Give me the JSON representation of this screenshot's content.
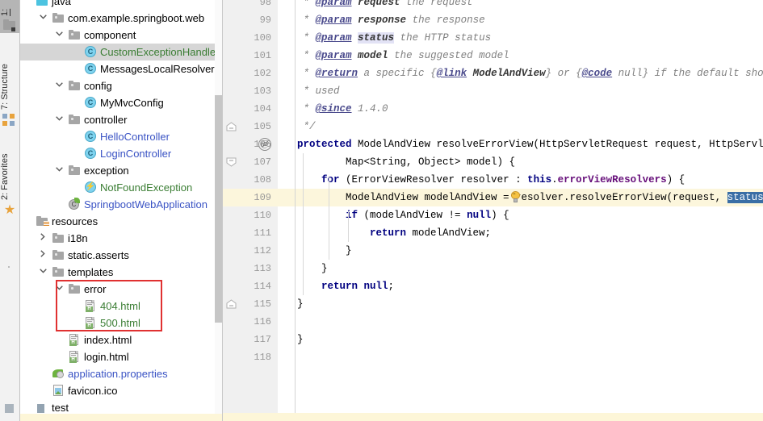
{
  "toolwindow_tabs": [
    {
      "id": "project",
      "label": "1:",
      "icon": "project-icon",
      "selected": true
    },
    {
      "id": "structure",
      "label": "7: Structure",
      "icon": "structure-icon",
      "selected": false
    },
    {
      "id": "favorites",
      "label": "2: Favorites",
      "icon": "star-icon",
      "selected": false
    }
  ],
  "project_tree": {
    "scrollbar_visible": true,
    "annotation": {
      "color": "#e03131",
      "shape": "rectangle",
      "targets": [
        "error",
        "404.html",
        "500.html"
      ]
    },
    "nodes": [
      {
        "label": "java",
        "icon": "source-root-icon",
        "indent": 0,
        "arrow": "none",
        "color": "#000000",
        "selected": false,
        "partial": true
      },
      {
        "label": "com.example.springboot.web",
        "icon": "folder-icon",
        "indent": 1,
        "arrow": "expanded",
        "color": "#000000",
        "selected": false
      },
      {
        "label": "component",
        "icon": "folder-icon",
        "indent": 2,
        "arrow": "expanded",
        "color": "#000000",
        "selected": false
      },
      {
        "label": "CustomExceptionHandler",
        "icon": "class-icon",
        "indent": 3,
        "arrow": "none",
        "color": "#3a7d33",
        "selected": true
      },
      {
        "label": "MessagesLocalResolver",
        "icon": "class-icon",
        "indent": 3,
        "arrow": "none",
        "color": "#000000",
        "selected": false
      },
      {
        "label": "config",
        "icon": "folder-icon",
        "indent": 2,
        "arrow": "expanded",
        "color": "#000000",
        "selected": false
      },
      {
        "label": "MyMvcConfig",
        "icon": "class-icon",
        "indent": 3,
        "arrow": "none",
        "color": "#000000",
        "selected": false
      },
      {
        "label": "controller",
        "icon": "folder-icon",
        "indent": 2,
        "arrow": "expanded",
        "color": "#000000",
        "selected": false
      },
      {
        "label": "HelloController",
        "icon": "class-icon",
        "indent": 3,
        "arrow": "none",
        "color": "#3a53c4",
        "selected": false
      },
      {
        "label": "LoginController",
        "icon": "class-icon",
        "indent": 3,
        "arrow": "none",
        "color": "#3a53c4",
        "selected": false
      },
      {
        "label": "exception",
        "icon": "folder-icon",
        "indent": 2,
        "arrow": "expanded",
        "color": "#000000",
        "selected": false
      },
      {
        "label": "NotFoundException",
        "icon": "exception-class-icon",
        "indent": 3,
        "arrow": "none",
        "color": "#3a7d33",
        "selected": false
      },
      {
        "label": "SpringbootWebApplication",
        "icon": "spring-boot-icon",
        "indent": 2,
        "arrow": "none",
        "color": "#3a53c4",
        "selected": false
      },
      {
        "label": "resources",
        "icon": "resources-root-icon",
        "indent": 0,
        "arrow": "none",
        "color": "#000000",
        "selected": false
      },
      {
        "label": "i18n",
        "icon": "folder-icon",
        "indent": 1,
        "arrow": "collapsed",
        "color": "#000000",
        "selected": false
      },
      {
        "label": "static.asserts",
        "icon": "folder-icon",
        "indent": 1,
        "arrow": "collapsed",
        "color": "#000000",
        "selected": false
      },
      {
        "label": "templates",
        "icon": "folder-icon",
        "indent": 1,
        "arrow": "expanded",
        "color": "#000000",
        "selected": false
      },
      {
        "label": "error",
        "icon": "folder-icon",
        "indent": 2,
        "arrow": "expanded",
        "color": "#000000",
        "selected": false
      },
      {
        "label": "404.html",
        "icon": "html-file-icon",
        "indent": 3,
        "arrow": "none",
        "color": "#3a7d33",
        "selected": false
      },
      {
        "label": "500.html",
        "icon": "html-file-icon",
        "indent": 3,
        "arrow": "none",
        "color": "#3a7d33",
        "selected": false
      },
      {
        "label": "index.html",
        "icon": "html-file-icon",
        "indent": 2,
        "arrow": "none",
        "color": "#000000",
        "selected": false
      },
      {
        "label": "login.html",
        "icon": "html-file-icon",
        "indent": 2,
        "arrow": "none",
        "color": "#000000",
        "selected": false
      },
      {
        "label": "application.properties",
        "icon": "properties-file-icon",
        "indent": 1,
        "arrow": "none",
        "color": "#3a53c4",
        "selected": false
      },
      {
        "label": "favicon.ico",
        "icon": "image-file-icon",
        "indent": 1,
        "arrow": "none",
        "color": "#000000",
        "selected": false
      },
      {
        "label": "test",
        "icon": "module-icon",
        "indent": 0,
        "arrow": "none",
        "color": "#000000",
        "selected": false
      }
    ]
  },
  "editor": {
    "first_line": 98,
    "caret_line": 109,
    "selected_text": "status",
    "gutter_markers": [
      {
        "line": 105,
        "type": "fold-end"
      },
      {
        "line": 106,
        "type": "override-method-marker",
        "glyph": "@"
      },
      {
        "line": 107,
        "type": "fold-start"
      },
      {
        "line": 109,
        "type": "intention-bulb"
      },
      {
        "line": 115,
        "type": "fold-end"
      }
    ],
    "lines": [
      {
        "num": 98,
        "text": " * @param request the request"
      },
      {
        "num": 99,
        "text": " * @param response the response"
      },
      {
        "num": 100,
        "text": " * @param status the HTTP status"
      },
      {
        "num": 101,
        "text": " * @param model the suggested model"
      },
      {
        "num": 102,
        "text": " * @return a specific {@link ModelAndView} or {@code null} if the default shou"
      },
      {
        "num": 103,
        "text": " * used"
      },
      {
        "num": 104,
        "text": " * @since 1.4.0"
      },
      {
        "num": 105,
        "text": " */"
      },
      {
        "num": 106,
        "text": "protected ModelAndView resolveErrorView(HttpServletRequest request, HttpServletR"
      },
      {
        "num": 107,
        "text": "        Map<String, Object> model) {"
      },
      {
        "num": 108,
        "text": "    for (ErrorViewResolver resolver : this.errorViewResolvers) {"
      },
      {
        "num": 109,
        "text": "        ModelAndView modelAndView = resolver.resolveErrorView(request, status, mo"
      },
      {
        "num": 110,
        "text": "        if (modelAndView != null) {"
      },
      {
        "num": 111,
        "text": "            return modelAndView;"
      },
      {
        "num": 112,
        "text": "        }"
      },
      {
        "num": 113,
        "text": "    }"
      },
      {
        "num": 114,
        "text": "    return null;"
      },
      {
        "num": 115,
        "text": "}"
      },
      {
        "num": 116,
        "text": ""
      },
      {
        "num": 117,
        "text": "}"
      },
      {
        "num": 118,
        "text": ""
      }
    ]
  }
}
